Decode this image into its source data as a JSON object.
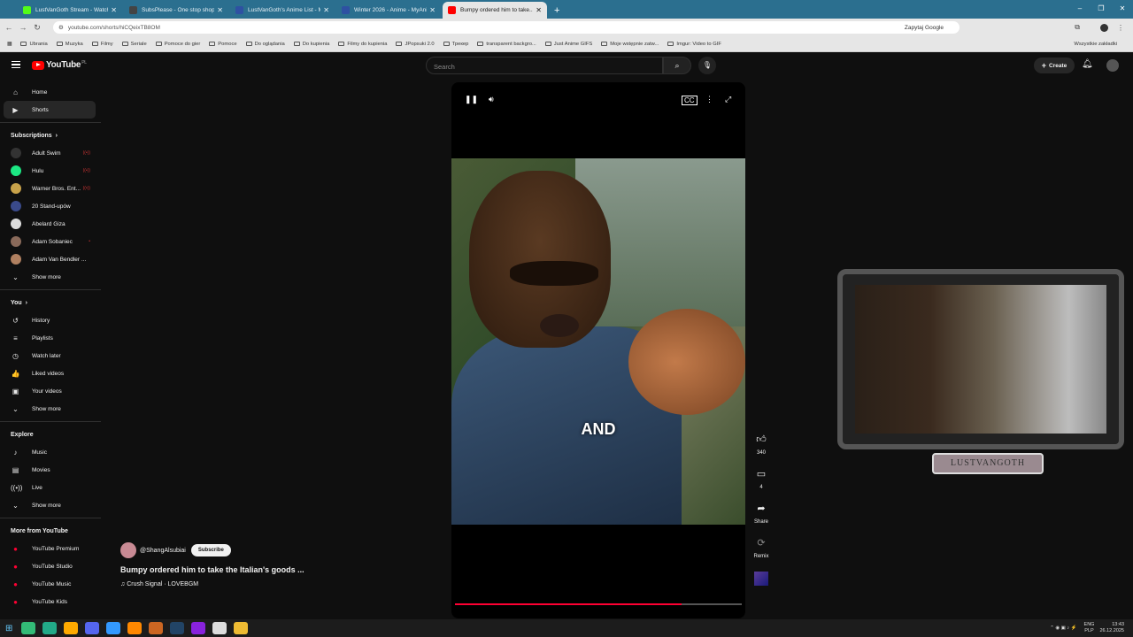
{
  "browser": {
    "tabs": [
      {
        "title": "LustVanGoth Stream - Watch Li...",
        "color": "#53fc18"
      },
      {
        "title": "SubsPlease - One stop shop fo...",
        "color": "#444444"
      },
      {
        "title": "LustVanGoth's Anime List - My...",
        "color": "#2e51a2"
      },
      {
        "title": "Winter 2026 - Anime - MyAnim...",
        "color": "#2e51a2"
      },
      {
        "title": "Bumpy ordered him to take...",
        "color": "#ff0000"
      }
    ],
    "new_tab": "+",
    "url": "youtube.com/shorts/hiCQeixTB8OM",
    "ask_google": "Zapytaj Google",
    "bookmarks": [
      "Ubrania",
      "Muzyka",
      "Filmy",
      "Seriale",
      "Pomoce do gier",
      "Pomoce",
      "Do oglądania",
      "Do kupienia",
      "Filmy do kupienia",
      "JPopsuki 2.0",
      "Трекер",
      "transparent backgro...",
      "Just Anime GIFS",
      "Moje wstępnie zatw...",
      "Imgur: Video to GIF"
    ],
    "bookmarks_all": "Wszystkie zakładki"
  },
  "youtube": {
    "logo_text": "YouTube",
    "logo_region": "PL",
    "search_placeholder": "Search",
    "create_label": "Create"
  },
  "sidebar": {
    "main": [
      {
        "label": "Home",
        "icon": "⌂"
      },
      {
        "label": "Shorts",
        "icon": "▶"
      }
    ],
    "subscriptions_title": "Subscriptions",
    "subscriptions": [
      {
        "label": "Adult Swim",
        "color": "#333333",
        "live": "((•))"
      },
      {
        "label": "Hulu",
        "color": "#1ce783",
        "live": "((•))"
      },
      {
        "label": "Warner Bros. Ent...",
        "color": "#c8a24a",
        "live": "((•))"
      },
      {
        "label": "20 Stand-upów",
        "color": "#3a4a8a",
        "live": ""
      },
      {
        "label": "Abelard Giza",
        "color": "#dddddd",
        "live": ""
      },
      {
        "label": "Adam Sobaniec",
        "color": "#8a6a5a",
        "live": "•"
      },
      {
        "label": "Adam Van Bendler ...",
        "color": "#b08060",
        "live": ""
      }
    ],
    "show_more": "Show more",
    "you_title": "You",
    "you": [
      {
        "label": "History",
        "icon": "↺"
      },
      {
        "label": "Playlists",
        "icon": "≡"
      },
      {
        "label": "Watch later",
        "icon": "◷"
      },
      {
        "label": "Liked videos",
        "icon": "👍"
      },
      {
        "label": "Your videos",
        "icon": "▣"
      }
    ],
    "explore_title": "Explore",
    "explore": [
      {
        "label": "Music",
        "icon": "♪"
      },
      {
        "label": "Movies",
        "icon": "▤"
      },
      {
        "label": "Live",
        "icon": "((•))"
      }
    ],
    "more_title": "More from YouTube",
    "more": [
      {
        "label": "YouTube Premium"
      },
      {
        "label": "YouTube Studio"
      },
      {
        "label": "YouTube Music"
      },
      {
        "label": "YouTube Kids"
      }
    ]
  },
  "video": {
    "caption": "AND",
    "progress": 0.79,
    "channel": "@ShangAlsubiai",
    "subscribe": "Subscribe",
    "title": "Bumpy ordered him to take the Italian's goods ...",
    "sound": "♫ Crush Signal · LOVEBGM"
  },
  "actions": {
    "likes": "340",
    "comments": "4",
    "share": "Share",
    "remix": "Remix"
  },
  "overlay": {
    "name": "LUSTVANGOTH"
  },
  "taskbar": {
    "lang": "ENG",
    "locale": "PLP",
    "time": "13:43",
    "date": "26.12.2025"
  }
}
